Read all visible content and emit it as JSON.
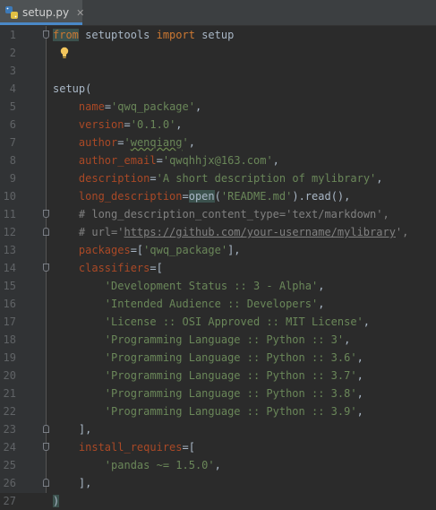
{
  "tab": {
    "title": "setup.py",
    "close_glyph": "✕",
    "icon": "python-file-icon"
  },
  "intention": {
    "icon": "lightbulb-icon"
  },
  "colors": {
    "keyword": "#cc7832",
    "parameter": "#aa4926",
    "string": "#6a8759",
    "comment": "#808080",
    "default": "#a9b7c6",
    "background": "#2b2b2b",
    "gutter": "#313335",
    "tab_underline": "#4a88c7"
  },
  "lines": [
    {
      "n": "1",
      "fold": "open",
      "tokens": [
        {
          "t": "from",
          "c": "kw hl"
        },
        {
          "t": " setuptools "
        },
        {
          "t": "import",
          "c": "kw"
        },
        {
          "t": " setup"
        }
      ]
    },
    {
      "n": "2",
      "bulb": true,
      "tokens": []
    },
    {
      "n": "3",
      "tokens": []
    },
    {
      "n": "4",
      "tokens": [
        {
          "t": "setup("
        }
      ]
    },
    {
      "n": "5",
      "tokens": [
        {
          "t": "    "
        },
        {
          "t": "name",
          "c": "par"
        },
        {
          "t": "="
        },
        {
          "t": "'qwq_package'",
          "c": "str"
        },
        {
          "t": ","
        }
      ]
    },
    {
      "n": "6",
      "tokens": [
        {
          "t": "    "
        },
        {
          "t": "version",
          "c": "par"
        },
        {
          "t": "="
        },
        {
          "t": "'0.1.0'",
          "c": "str"
        },
        {
          "t": ","
        }
      ]
    },
    {
      "n": "7",
      "tokens": [
        {
          "t": "    "
        },
        {
          "t": "author",
          "c": "par"
        },
        {
          "t": "="
        },
        {
          "t": "'",
          "c": "str"
        },
        {
          "t": "wenqiang",
          "c": "str typo"
        },
        {
          "t": "'",
          "c": "str"
        },
        {
          "t": ","
        }
      ]
    },
    {
      "n": "8",
      "tokens": [
        {
          "t": "    "
        },
        {
          "t": "author_email",
          "c": "par"
        },
        {
          "t": "="
        },
        {
          "t": "'qwqhhjx@163.com'",
          "c": "str"
        },
        {
          "t": ","
        }
      ]
    },
    {
      "n": "9",
      "tokens": [
        {
          "t": "    "
        },
        {
          "t": "description",
          "c": "par"
        },
        {
          "t": "="
        },
        {
          "t": "'A short description of mylibrary'",
          "c": "str"
        },
        {
          "t": ","
        }
      ]
    },
    {
      "n": "10",
      "tokens": [
        {
          "t": "    "
        },
        {
          "t": "long_description",
          "c": "par"
        },
        {
          "t": "="
        },
        {
          "t": "open",
          "c": "hl"
        },
        {
          "t": "("
        },
        {
          "t": "'README.md'",
          "c": "str"
        },
        {
          "t": ").read(),"
        }
      ]
    },
    {
      "n": "11",
      "fold": "open",
      "tokens": [
        {
          "t": "    "
        },
        {
          "t": "# long_description_content_type='text/markdown',",
          "c": "cmt"
        }
      ]
    },
    {
      "n": "12",
      "fold": "close",
      "tokens": [
        {
          "t": "    "
        },
        {
          "t": "# url='",
          "c": "cmt"
        },
        {
          "t": "https://github.com/your-username/mylibrary",
          "c": "url"
        },
        {
          "t": "',",
          "c": "cmt"
        }
      ]
    },
    {
      "n": "13",
      "tokens": [
        {
          "t": "    "
        },
        {
          "t": "packages",
          "c": "par"
        },
        {
          "t": "=["
        },
        {
          "t": "'qwq_package'",
          "c": "str"
        },
        {
          "t": "],"
        }
      ]
    },
    {
      "n": "14",
      "fold": "open",
      "tokens": [
        {
          "t": "    "
        },
        {
          "t": "classifiers",
          "c": "par"
        },
        {
          "t": "=["
        }
      ]
    },
    {
      "n": "15",
      "tokens": [
        {
          "t": "        "
        },
        {
          "t": "'Development Status :: 3 - Alpha'",
          "c": "str"
        },
        {
          "t": ","
        }
      ]
    },
    {
      "n": "16",
      "tokens": [
        {
          "t": "        "
        },
        {
          "t": "'Intended Audience :: Developers'",
          "c": "str"
        },
        {
          "t": ","
        }
      ]
    },
    {
      "n": "17",
      "tokens": [
        {
          "t": "        "
        },
        {
          "t": "'License :: OSI Approved :: MIT License'",
          "c": "str"
        },
        {
          "t": ","
        }
      ]
    },
    {
      "n": "18",
      "tokens": [
        {
          "t": "        "
        },
        {
          "t": "'Programming Language :: Python :: 3'",
          "c": "str"
        },
        {
          "t": ","
        }
      ]
    },
    {
      "n": "19",
      "tokens": [
        {
          "t": "        "
        },
        {
          "t": "'Programming Language :: Python :: 3.6'",
          "c": "str"
        },
        {
          "t": ","
        }
      ]
    },
    {
      "n": "20",
      "tokens": [
        {
          "t": "        "
        },
        {
          "t": "'Programming Language :: Python :: 3.7'",
          "c": "str"
        },
        {
          "t": ","
        }
      ]
    },
    {
      "n": "21",
      "tokens": [
        {
          "t": "        "
        },
        {
          "t": "'Programming Language :: Python :: 3.8'",
          "c": "str"
        },
        {
          "t": ","
        }
      ]
    },
    {
      "n": "22",
      "tokens": [
        {
          "t": "        "
        },
        {
          "t": "'Programming Language :: Python :: 3.9'",
          "c": "str"
        },
        {
          "t": ","
        }
      ]
    },
    {
      "n": "23",
      "fold": "close",
      "tokens": [
        {
          "t": "    ],"
        }
      ]
    },
    {
      "n": "24",
      "fold": "open",
      "tokens": [
        {
          "t": "    "
        },
        {
          "t": "install_requires",
          "c": "par"
        },
        {
          "t": "=["
        }
      ]
    },
    {
      "n": "25",
      "tokens": [
        {
          "t": "        "
        },
        {
          "t": "'pandas ~= 1.5.0'",
          "c": "str"
        },
        {
          "t": ","
        }
      ]
    },
    {
      "n": "26",
      "fold": "close",
      "tokens": [
        {
          "t": "    ],"
        }
      ]
    },
    {
      "n": "27",
      "tokens": [
        {
          "t": ")",
          "c": "hl"
        }
      ]
    }
  ]
}
